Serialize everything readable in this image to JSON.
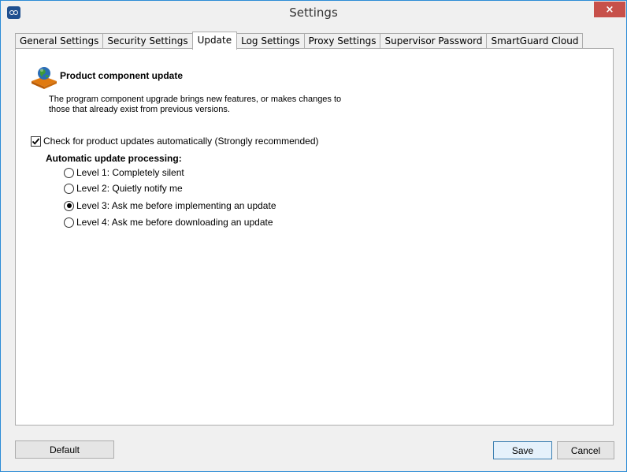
{
  "window": {
    "title": "Settings",
    "close_icon": "×"
  },
  "tabs": [
    {
      "label": "General Settings",
      "active": false
    },
    {
      "label": "Security Settings",
      "active": false
    },
    {
      "label": "Update",
      "active": true
    },
    {
      "label": "Log Settings",
      "active": false
    },
    {
      "label": "Proxy Settings",
      "active": false
    },
    {
      "label": "Supervisor Password",
      "active": false
    },
    {
      "label": "SmartGuard Cloud",
      "active": false
    }
  ],
  "update": {
    "title": "Product component update",
    "description": "The program component upgrade brings new features, or makes changes to those that already exist from previous versions.",
    "auto_check": {
      "label": "Check for product updates automatically (Strongly recommended)",
      "checked": true
    },
    "group_label": "Automatic update processing:",
    "levels": [
      {
        "label": "Level 1: Completely silent",
        "selected": false
      },
      {
        "label": "Level 2: Quietly notify me",
        "selected": false
      },
      {
        "label": "Level 3: Ask me before implementing an update",
        "selected": true
      },
      {
        "label": "Level 4: Ask me before downloading an update",
        "selected": false
      }
    ]
  },
  "buttons": {
    "default": "Default",
    "save": "Save",
    "cancel": "Cancel"
  },
  "colors": {
    "accent": "#2b8bd6",
    "close": "#c7504a",
    "save_border": "#3c7fb1"
  }
}
